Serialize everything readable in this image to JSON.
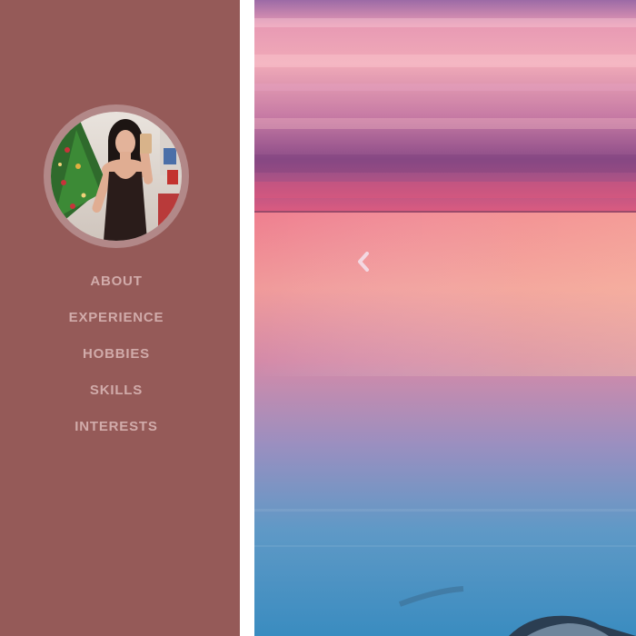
{
  "sidebar": {
    "background_color": "#955a58",
    "nav_text_color": "#d1abaa",
    "profile_photo": "profile-photo",
    "nav": [
      {
        "label": "ABOUT"
      },
      {
        "label": "EXPERIENCE"
      },
      {
        "label": "HOBBIES"
      },
      {
        "label": "SKILLS"
      },
      {
        "label": "INTERESTS"
      }
    ]
  },
  "hero": {
    "image": "sunset-sea-landscape",
    "prev_icon": "chevron-left-icon"
  }
}
